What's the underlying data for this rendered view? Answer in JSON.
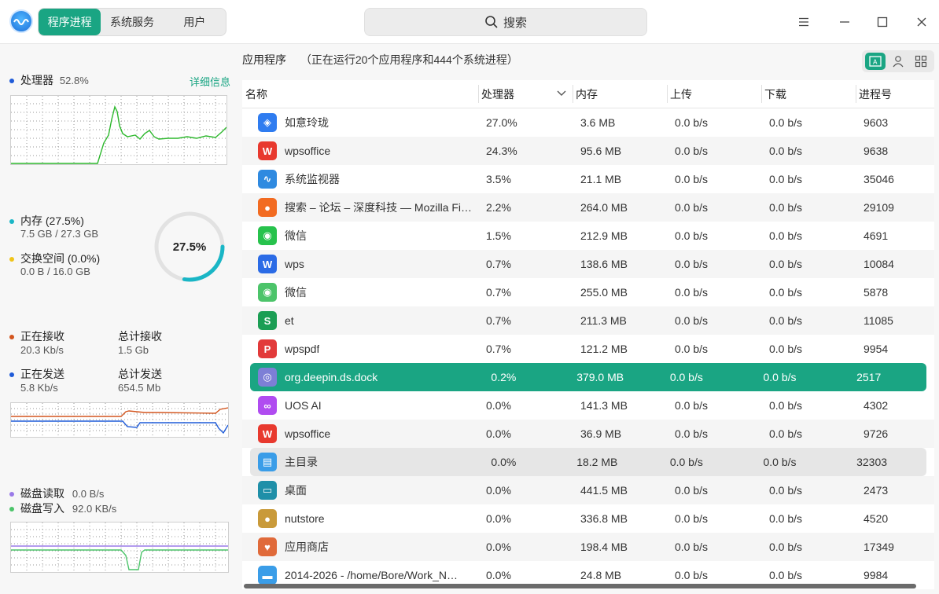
{
  "tabs": [
    "程序进程",
    "系统服务",
    "用户"
  ],
  "search": {
    "placeholder": "搜索"
  },
  "left": {
    "cpu": {
      "label": "处理器",
      "value": "52.8%",
      "details_link": "详细信息"
    },
    "memory": {
      "label": "内存 (27.5%)",
      "value": "7.5 GB / 27.3 GB",
      "ring_text": "27.5%",
      "ring_fraction": 0.275
    },
    "swap": {
      "label": "交换空间 (0.0%)",
      "value": "0.0 B / 16.0 GB"
    },
    "network": {
      "recv_label": "正在接收",
      "recv_value": "20.3 Kb/s",
      "total_recv_label": "总计接收",
      "total_recv_value": "1.5 Gb",
      "send_label": "正在发送",
      "send_value": "5.8 Kb/s",
      "total_send_label": "总计发送",
      "total_send_value": "654.5 Mb"
    },
    "disk": {
      "read_label": "磁盘读取",
      "read_value": "0.0 B/s",
      "write_label": "磁盘写入",
      "write_value": "92.0 KB/s"
    }
  },
  "header": {
    "title": "应用程序",
    "count": "（正在运行20个应用程序和444个系统进程）"
  },
  "columns": [
    "名称",
    "处理器",
    "内存",
    "上传",
    "下载",
    "进程号"
  ],
  "rows": [
    {
      "name": "如意玲珑",
      "cpu": "27.0%",
      "mem": "3.6 MB",
      "up": "0.0 b/s",
      "down": "0.0 b/s",
      "pid": "9603",
      "icon": "cube-icon",
      "color": "#2f7cf0",
      "glyph": "◈"
    },
    {
      "name": "wpsoffice",
      "cpu": "24.3%",
      "mem": "95.6 MB",
      "up": "0.0 b/s",
      "down": "0.0 b/s",
      "pid": "9638",
      "icon": "wps-icon",
      "color": "#e8392e",
      "glyph": "W"
    },
    {
      "name": "系统监视器",
      "cpu": "3.5%",
      "mem": "21.1 MB",
      "up": "0.0 b/s",
      "down": "0.0 b/s",
      "pid": "35046",
      "icon": "monitor-icon",
      "color": "#2f8ae0",
      "glyph": "∿"
    },
    {
      "name": "搜索 – 论坛 – 深度科技 — Mozilla Firefox",
      "cpu": "2.2%",
      "mem": "264.0 MB",
      "up": "0.0 b/s",
      "down": "0.0 b/s",
      "pid": "29109",
      "icon": "firefox-icon",
      "color": "#f26b21",
      "glyph": "●"
    },
    {
      "name": "微信",
      "cpu": "1.5%",
      "mem": "212.9 MB",
      "up": "0.0 b/s",
      "down": "0.0 b/s",
      "pid": "4691",
      "icon": "wechat-icon",
      "color": "#27c24c",
      "glyph": "◉"
    },
    {
      "name": "wps",
      "cpu": "0.7%",
      "mem": "138.6 MB",
      "up": "0.0 b/s",
      "down": "0.0 b/s",
      "pid": "10084",
      "icon": "wps-writer-icon",
      "color": "#2b6be6",
      "glyph": "W"
    },
    {
      "name": "微信",
      "cpu": "0.7%",
      "mem": "255.0 MB",
      "up": "0.0 b/s",
      "down": "0.0 b/s",
      "pid": "5878",
      "icon": "wechat-icon",
      "color": "#4cc46a",
      "glyph": "◉"
    },
    {
      "name": "et",
      "cpu": "0.7%",
      "mem": "211.3 MB",
      "up": "0.0 b/s",
      "down": "0.0 b/s",
      "pid": "11085",
      "icon": "spreadsheet-icon",
      "color": "#1b9e54",
      "glyph": "S"
    },
    {
      "name": "wpspdf",
      "cpu": "0.7%",
      "mem": "121.2 MB",
      "up": "0.0 b/s",
      "down": "0.0 b/s",
      "pid": "9954",
      "icon": "pdf-icon",
      "color": "#e23a3a",
      "glyph": "P"
    },
    {
      "name": "org.deepin.ds.dock",
      "cpu": "0.2%",
      "mem": "379.0 MB",
      "up": "0.0 b/s",
      "down": "0.0 b/s",
      "pid": "2517",
      "icon": "dock-icon",
      "color": "#7d7fd6",
      "glyph": "◎",
      "selected": true
    },
    {
      "name": "UOS AI",
      "cpu": "0.0%",
      "mem": "141.3 MB",
      "up": "0.0 b/s",
      "down": "0.0 b/s",
      "pid": "4302",
      "icon": "ai-icon",
      "color": "#b04cf0",
      "glyph": "∞"
    },
    {
      "name": "wpsoffice",
      "cpu": "0.0%",
      "mem": "36.9 MB",
      "up": "0.0 b/s",
      "down": "0.0 b/s",
      "pid": "9726",
      "icon": "wps-icon",
      "color": "#e8392e",
      "glyph": "W"
    },
    {
      "name": "主目录",
      "cpu": "0.0%",
      "mem": "18.2 MB",
      "up": "0.0 b/s",
      "down": "0.0 b/s",
      "pid": "32303",
      "icon": "folder-icon",
      "color": "#3a9de8",
      "glyph": "▤",
      "hover": true
    },
    {
      "name": "桌面",
      "cpu": "0.0%",
      "mem": "441.5 MB",
      "up": "0.0 b/s",
      "down": "0.0 b/s",
      "pid": "2473",
      "icon": "desktop-icon",
      "color": "#1f8fa8",
      "glyph": "▭"
    },
    {
      "name": "nutstore",
      "cpu": "0.0%",
      "mem": "336.8 MB",
      "up": "0.0 b/s",
      "down": "0.0 b/s",
      "pid": "4520",
      "icon": "nutstore-icon",
      "color": "#c99a3a",
      "glyph": "●"
    },
    {
      "name": "应用商店",
      "cpu": "0.0%",
      "mem": "198.4 MB",
      "up": "0.0 b/s",
      "down": "0.0 b/s",
      "pid": "17349",
      "icon": "store-icon",
      "color": "#e06a3a",
      "glyph": "♥"
    },
    {
      "name": "2014-2026 - /home/Bore/Work_N…",
      "cpu": "0.0%",
      "mem": "24.8 MB",
      "up": "0.0 b/s",
      "down": "0.0 b/s",
      "pid": "9984",
      "icon": "folder-icon",
      "color": "#3a9de8",
      "glyph": "▬"
    }
  ],
  "colors": {
    "accent": "#1aa583",
    "cpu_line": "#2db82d",
    "recv_line": "#d3551e",
    "send_line": "#1f5bd8",
    "disk_read": "#9a7ae8",
    "disk_write": "#4cc46a",
    "mem_ring": "#1ab6c6"
  }
}
